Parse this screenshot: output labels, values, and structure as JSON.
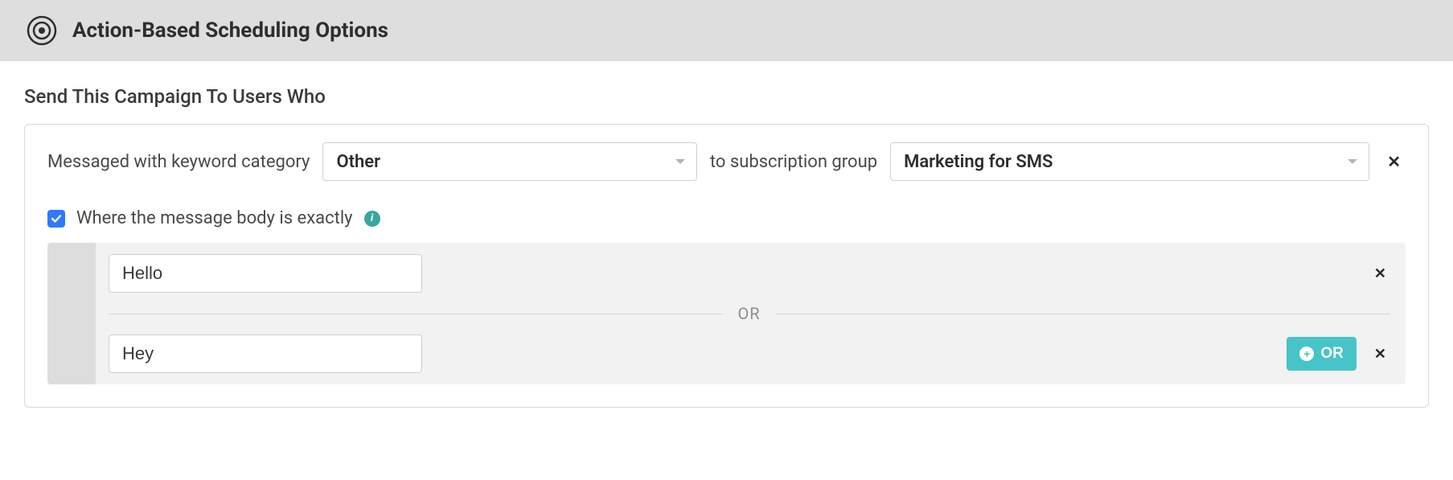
{
  "header": {
    "title": "Action-Based Scheduling Options"
  },
  "section": {
    "title": "Send This Campaign To Users Who"
  },
  "rule": {
    "prefix_label": "Messaged with keyword category",
    "category_value": "Other",
    "mid_label": "to subscription group",
    "subscription_value": "Marketing for SMS"
  },
  "body_match": {
    "checkbox_checked": true,
    "label": "Where the message body is exactly",
    "or_separator": "OR",
    "add_or_label": "OR",
    "rows": [
      {
        "value": "Hello"
      },
      {
        "value": "Hey"
      }
    ]
  }
}
